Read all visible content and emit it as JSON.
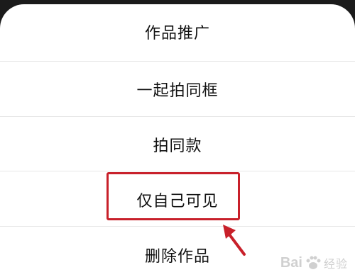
{
  "menu": {
    "items": [
      {
        "label": "作品推广"
      },
      {
        "label": "一起拍同框"
      },
      {
        "label": "拍同款"
      },
      {
        "label": "仅自己可见"
      },
      {
        "label": "删除作品"
      }
    ]
  },
  "annotation": {
    "highlight_color": "#c8202a",
    "highlighted_item": "仅自己可见"
  },
  "watermark": {
    "brand": "Bai",
    "suffix": "经验"
  }
}
